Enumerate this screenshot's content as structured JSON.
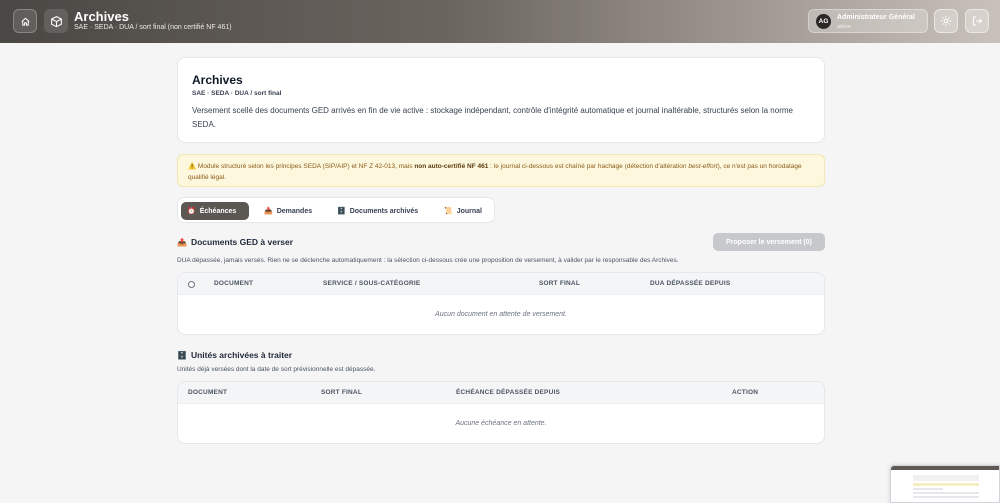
{
  "header": {
    "title": "Archives",
    "subtitle": "SAE · SEDA · DUA / sort final (non certifié NF 461)",
    "user": {
      "initials": "AG",
      "name": "Administrateur Général",
      "role": "admin"
    }
  },
  "intro": {
    "title": "Archives",
    "tag": "SAE · SEDA · DUA / sort final",
    "description": "Versement scellé des documents GED arrivés en fin de vie active : stockage indépendant, contrôle d'intégrité automatique et journal inaltérable, structurés selon la norme SEDA."
  },
  "warning": {
    "icon": "warning-icon",
    "part1": "Module structuré selon les principes SEDA (SIP/AIP) et NF Z 42-013, mais ",
    "bold": "non auto-certifié NF 461",
    "part2": " : le journal ci-dessous est chaîné par hachage (détection d'altération ",
    "italic": "best-effort",
    "part3": "), ce n'est pas un horodatage qualifié légal."
  },
  "tabs": [
    {
      "label": "Échéances",
      "icon": "clock-icon",
      "active": true
    },
    {
      "label": "Demandes",
      "icon": "inbox-icon",
      "active": false
    },
    {
      "label": "Documents archivés",
      "icon": "cabinet-icon",
      "active": false
    },
    {
      "label": "Journal",
      "icon": "ledger-icon",
      "active": false
    }
  ],
  "section_ged": {
    "title": "Documents GED à verser",
    "icon": "inbox-tray-icon",
    "description": "DUA dépassée, jamais versés. Rien ne se déclenche automatiquement : la sélection ci-dessous crée une proposition de versement, à valider par le responsable des Archives.",
    "button": "Proposer le versement (0)",
    "columns": [
      "DOCUMENT",
      "SERVICE / SOUS-CATÉGORIE",
      "SORT FINAL",
      "DUA DÉPASSÉE DEPUIS"
    ],
    "empty": "Aucun document en attente de versement."
  },
  "section_units": {
    "title": "Unités archivées à traiter",
    "icon": "file-cabinet-icon",
    "description": "Unités déjà versées dont la date de sort prévisionnelle est dépassée.",
    "columns": [
      "DOCUMENT",
      "SORT FINAL",
      "ÉCHÉANCE DÉPASSÉE DEPUIS",
      "ACTION"
    ],
    "empty": "Aucune échéance en attente."
  },
  "colors": {
    "header_dark": "#4a4744",
    "tab_active": "#5b5753",
    "warning_bg": "#fdf8dd",
    "warning_text": "#8a5a1a"
  }
}
